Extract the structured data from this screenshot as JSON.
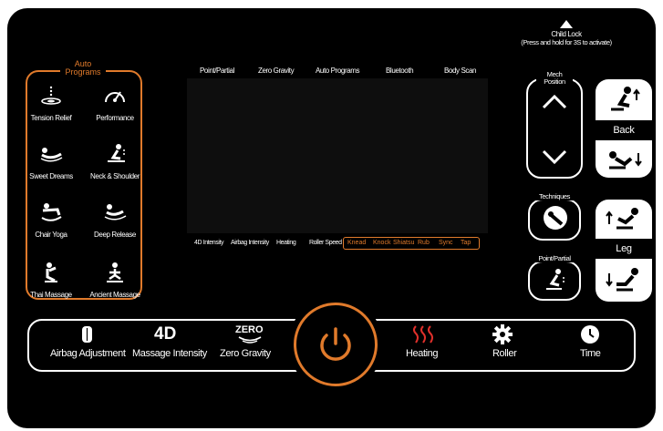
{
  "child_lock": {
    "title": "Child Lock",
    "hint": "(Press and hold for 3S to activate)"
  },
  "auto_programs": {
    "title": "Auto\nPrograms",
    "items": [
      {
        "label": "Tension Relief",
        "icon": "tension-relief-icon"
      },
      {
        "label": "Performance",
        "icon": "performance-gauge-icon"
      },
      {
        "label": "Sweet Dreams",
        "icon": "sweet-dreams-icon"
      },
      {
        "label": "Neck & Shoulder",
        "icon": "neck-shoulder-icon"
      },
      {
        "label": "Chair Yoga",
        "icon": "chair-yoga-icon"
      },
      {
        "label": "Deep Release",
        "icon": "deep-release-icon"
      },
      {
        "label": "Thai Massage",
        "icon": "thai-massage-icon"
      },
      {
        "label": "Ancient Massage",
        "icon": "ancient-massage-icon"
      }
    ]
  },
  "screen": {
    "top_labels": [
      "Point/Partial",
      "Zero Gravity",
      "Auto Programs",
      "Bluetooth",
      "Body Scan"
    ],
    "bottom_labels": [
      "4D Intensity",
      "Airbag Intensity",
      "Heating",
      "Roller Speed"
    ],
    "modes": [
      "Knead",
      "Knock",
      "Shiatsu",
      "Rub",
      "Sync",
      "Tap"
    ]
  },
  "mech_position": {
    "label": "Mech\nPosition"
  },
  "back": {
    "label": "Back"
  },
  "techniques": {
    "label": "Techniques"
  },
  "leg": {
    "label": "Leg"
  },
  "point_partial": {
    "label": "Point/Partial"
  },
  "bottom_bar": {
    "airbag": "Airbag Adjustment",
    "intensity_title": "4D",
    "intensity": "Massage Intensity",
    "zero_title": "ZERO",
    "zero": "Zero Gravity",
    "heating": "Heating",
    "roller": "Roller",
    "time": "Time"
  },
  "colors": {
    "accent": "#e07a2b",
    "heating": "#e0302b",
    "panel": "#000000"
  }
}
